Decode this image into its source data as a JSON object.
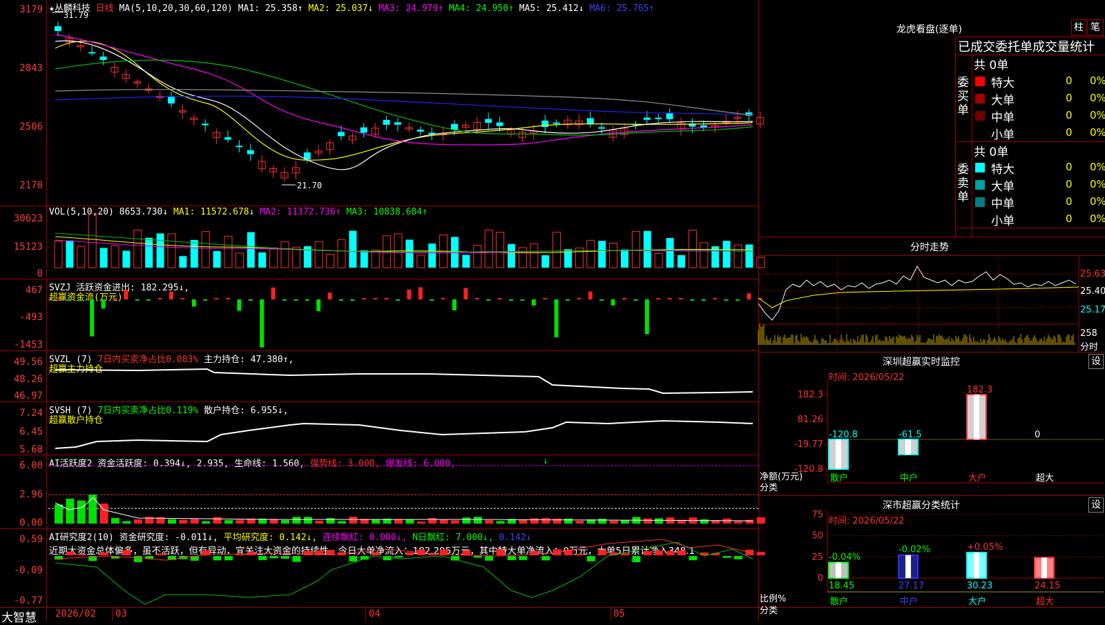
{
  "stock": {
    "name": "丛麟科技",
    "period": "日线",
    "high_mark": "31.79",
    "low_mark": "21.70",
    "star": "★"
  },
  "ma_header": {
    "label": "MA(5,10,20,30,60,120)",
    "ma1": "MA1: 25.358↑",
    "ma2": "MA2: 25.037↓",
    "ma3": "MA3: 24.979↑",
    "ma4": "MA4: 24.950↑",
    "ma5": "MA5: 25.412↓",
    "ma6": "MA6: 25.765↑"
  },
  "price_axis": [
    "3179",
    "2843",
    "2506",
    "2170"
  ],
  "vol_header": {
    "label": "VOL(5,10,20)",
    "value": "8653.730↓",
    "ma1": "MA1: 11572.678↓",
    "ma2": "MA2: 11372.736↑",
    "ma3": "MA3: 10838.684↑"
  },
  "vol_axis": [
    "30623",
    "15123",
    "0"
  ],
  "svzj_header": {
    "label": "SVZJ",
    "value": "活跃资金进出: 182.295↓,",
    "sub": "超赢资金流(万元)"
  },
  "svzj_axis": [
    "467",
    "-493",
    "-1453"
  ],
  "svzl_header": {
    "label": "SVZL (7)",
    "ratio": "7日内买卖净占比0.083%",
    "value": "主力持仓: 47.380↑,",
    "sub": "超赢主力持仓"
  },
  "svzl_axis": [
    "49.56",
    "48.26",
    "46.97"
  ],
  "svsh_header": {
    "label": "SVSH (7)",
    "ratio": "7日内买卖净占比0.119%",
    "value": "散户持仓: 6.955↓,",
    "sub": "超赢散户持仓"
  },
  "svsh_axis": [
    "7.24",
    "6.45",
    "5.68"
  ],
  "ai1_header": {
    "label": "AI活跃度2",
    "v1": "资金活跃度: 0.394↓, 2.935, 生命线: 1.560,",
    "v2": "强势线: 3.000,",
    "v3": "爆发线: 6.000,",
    "arrow": "↓"
  },
  "ai1_axis": [
    "6.00",
    "2.96",
    "0.00"
  ],
  "ai2_header": {
    "label": "AI研究度2(10)",
    "v1": "资金研究度: -0.011↓,",
    "v2": "平均研究度: 0.142↓,",
    "v3": "连续飘红: 0.000↓,",
    "v4": "N日飘红: 7.000↓,",
    "v5": "0.142↓"
  },
  "ai2_text": "近期大资金总体偏多，虽不活跃，但有异动，宜关注大资金的持续性，今日大单净流入：182.295万元，其中特大单净流入：0万元，大单5日累计净入348.1",
  "ai2_axis": [
    "0.59",
    "-0.09",
    "-0.77"
  ],
  "date_axis": {
    "brand": "大智慧",
    "d1": "2026/02",
    "d2": "03",
    "d3": "04",
    "d4": "05"
  },
  "right": {
    "title": "龙虎看盘(逐单)",
    "btn1": "柱",
    "btn2": "笔",
    "stats_title": "已成交委托单成交量统计",
    "buy_label": "委买单",
    "sell_label": "委卖单",
    "buy_total": "共 0单",
    "sell_total": "共 0单",
    "buy_rows": [
      {
        "name": "特大",
        "count": "0",
        "pct": "0%",
        "color": "#ff0000"
      },
      {
        "name": "大单",
        "count": "0",
        "pct": "0%",
        "color": "#a00000"
      },
      {
        "name": "中单",
        "count": "0",
        "pct": "0%",
        "color": "#700000"
      },
      {
        "name": "小单",
        "count": "0",
        "pct": "0%",
        "color": "#000000"
      }
    ],
    "sell_rows": [
      {
        "name": "特大",
        "count": "0",
        "pct": "0%",
        "color": "#00ffff"
      },
      {
        "name": "大单",
        "count": "0",
        "pct": "0%",
        "color": "#00a0a0"
      },
      {
        "name": "中单",
        "count": "0",
        "pct": "0%",
        "color": "#008080"
      },
      {
        "name": "小单",
        "count": "0",
        "pct": "0%",
        "color": "#000000"
      }
    ],
    "intraday_title": "分时走势",
    "intraday_axis": [
      "25.63",
      "25.40",
      "25.17",
      "258",
      "分时"
    ],
    "monitor_title": "深圳超赢实时监控",
    "monitor_time": "时间: 2026/05/22",
    "monitor_axis": [
      "182.3",
      "81.26",
      "-19.77",
      "-120.8"
    ],
    "monitor_ylabel": "净额(万元)",
    "monitor_xlabel": "分类",
    "monitor_values": [
      {
        "name": "散户",
        "value": -120.8,
        "label": "-120.8"
      },
      {
        "name": "中户",
        "value": -61.5,
        "label": "-61.5"
      },
      {
        "name": "大户",
        "value": 182.3,
        "label": "182.3"
      },
      {
        "name": "超大",
        "value": 0,
        "label": "0"
      }
    ],
    "set_btn": "设",
    "class_title": "深市超赢分类统计",
    "class_time": "时间: 2026/05/22",
    "class_axis": [
      "75",
      "50",
      "25",
      "0"
    ],
    "class_ylabel": "比例%",
    "class_xlabel": "分类",
    "class_values": [
      {
        "name": "散户",
        "value": 18.45,
        "label": "18.45",
        "change": "-0.04%"
      },
      {
        "name": "中户",
        "value": 27.17,
        "label": "27.17",
        "change": "-0.02%"
      },
      {
        "name": "大户",
        "value": 30.23,
        "label": "30.23",
        "change": "+0.05%"
      },
      {
        "name": "超大",
        "value": 24.15,
        "label": "24.15",
        "change": ""
      }
    ]
  }
}
